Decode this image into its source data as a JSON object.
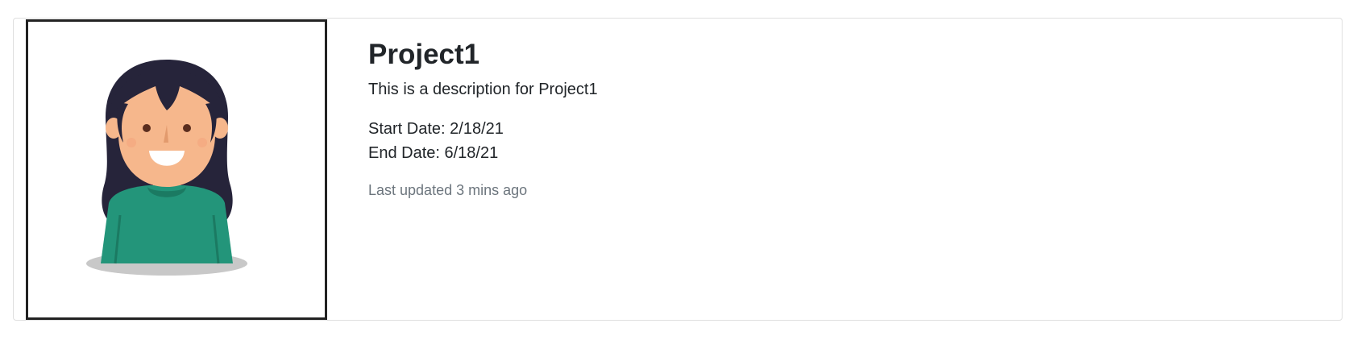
{
  "card": {
    "title": "Project1",
    "description": "This is a description for Project1",
    "start_date": "Start Date: 2/18/21",
    "end_date": "End Date: 6/18/21",
    "last_updated": "Last updated 3 mins ago",
    "avatar_icon": "woman-avatar-icon"
  },
  "colors": {
    "hair": "#26243a",
    "skin": "#f6b78c",
    "shirt": "#23957a",
    "shirt_dark": "#1b7a62",
    "shadow": "#c8c8c8",
    "muted_text": "#6c757d",
    "frame_border": "#222222"
  }
}
